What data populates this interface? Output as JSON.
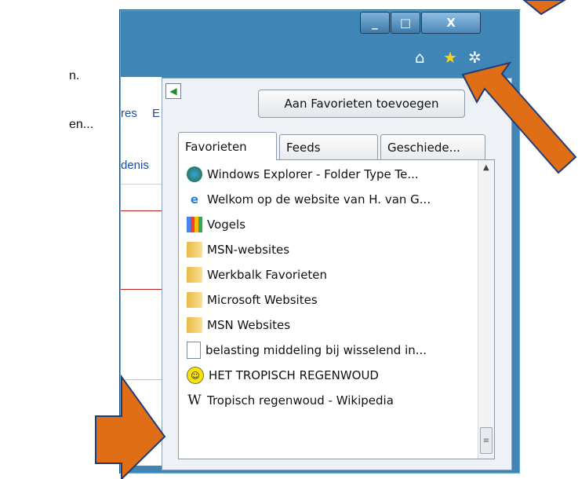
{
  "background_text": [
    "n.",
    "en..."
  ],
  "window": {
    "buttons": {
      "minimize": "_",
      "maximize": "□",
      "close": "X"
    },
    "toolbar_icons": [
      "home-icon",
      "star-icon",
      "gear-icon"
    ]
  },
  "content": {
    "links": [
      "res",
      "E",
      "denis"
    ]
  },
  "favorites_panel": {
    "add_button": "Aan Favorieten toevoegen",
    "tabs": [
      "Favorieten",
      "Feeds",
      "Geschiede..."
    ],
    "items": [
      {
        "label": "Windows Explorer - Folder Type Te...",
        "icon": "browser-icon"
      },
      {
        "label": "Welkom op de website van H. van G...",
        "icon": "ie-icon"
      },
      {
        "label": "Vogels",
        "icon": "google-icon"
      },
      {
        "label": "MSN-websites",
        "icon": "folder-icon"
      },
      {
        "label": "Werkbalk Favorieten",
        "icon": "folder-icon"
      },
      {
        "label": "Microsoft Websites",
        "icon": "folder-icon"
      },
      {
        "label": "MSN Websites",
        "icon": "folder-icon"
      },
      {
        "label": "belasting middeling bij wisselend in...",
        "icon": "page-icon"
      },
      {
        "label": "HET TROPISCH REGENWOUD",
        "icon": "smiley-icon"
      },
      {
        "label": "Tropisch regenwoud - Wikipedia",
        "icon": "wikipedia-icon"
      }
    ]
  },
  "colors": {
    "window_frame": "#3f86b7",
    "annotation_arrow": "#e06e16",
    "link": "#1a4d9e"
  }
}
